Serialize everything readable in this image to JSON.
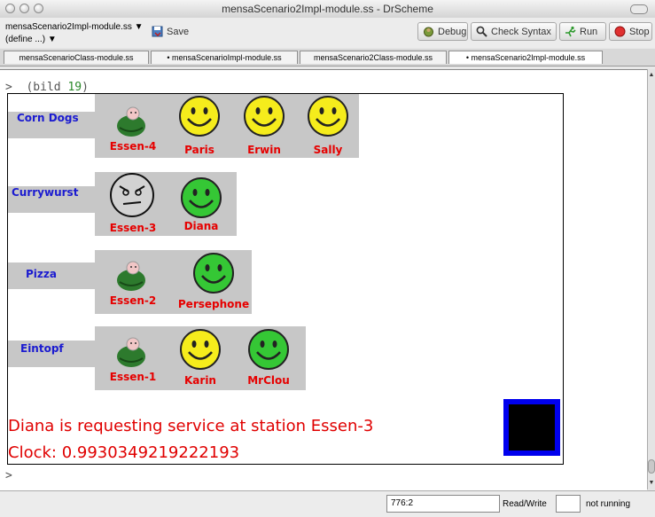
{
  "window": {
    "title": "mensaScenario2Impl-module.ss - DrScheme"
  },
  "toolbar": {
    "file_select": "mensaScenario2Impl-module.ss",
    "define_menu": "(define ...)",
    "save_label": "Save",
    "debug_label": "Debug",
    "check_syntax_label": "Check Syntax",
    "run_label": "Run",
    "stop_label": "Stop"
  },
  "tabs": [
    "mensaScenarioClass-module.ss",
    "• mensaScenarioImpl-module.ss",
    "mensaScenario2Class-module.ss",
    "• mensaScenario2Impl-module.ss"
  ],
  "repl": {
    "prompt": ">",
    "command_open": "(bild ",
    "command_arg": "19",
    "command_close": ")",
    "prompt2": ">"
  },
  "scene": {
    "stations": [
      {
        "food": "Corn Dogs",
        "station": "Essen-4",
        "station_face": "cook",
        "customers": [
          {
            "name": "Paris",
            "face": "yellow"
          },
          {
            "name": "Erwin",
            "face": "yellow"
          },
          {
            "name": "Sally",
            "face": "yellow"
          }
        ]
      },
      {
        "food": "Currywurst",
        "station": "Essen-3",
        "station_face": "angry",
        "customers": [
          {
            "name": "Diana",
            "face": "green"
          }
        ]
      },
      {
        "food": "Pizza",
        "station": "Essen-2",
        "station_face": "cook",
        "customers": [
          {
            "name": "Persephone",
            "face": "green"
          }
        ]
      },
      {
        "food": "Eintopf",
        "station": "Essen-1",
        "station_face": "cook",
        "customers": [
          {
            "name": "Karin",
            "face": "yellow"
          },
          {
            "name": "MrClou",
            "face": "green"
          }
        ]
      }
    ],
    "message": "Diana is requesting service at station Essen-3",
    "clock": "Clock: 0.9930349219222193",
    "colors": {
      "yellow_face": "#f5ec1c",
      "green_face": "#35c735",
      "label_red": "#e60000",
      "food_blue": "#1b1bd0",
      "panel_grey": "#c7c7c7",
      "box_blue": "#0000ee"
    }
  },
  "status": {
    "position": "776:2",
    "read_write": "Read/Write",
    "running": "not running"
  }
}
